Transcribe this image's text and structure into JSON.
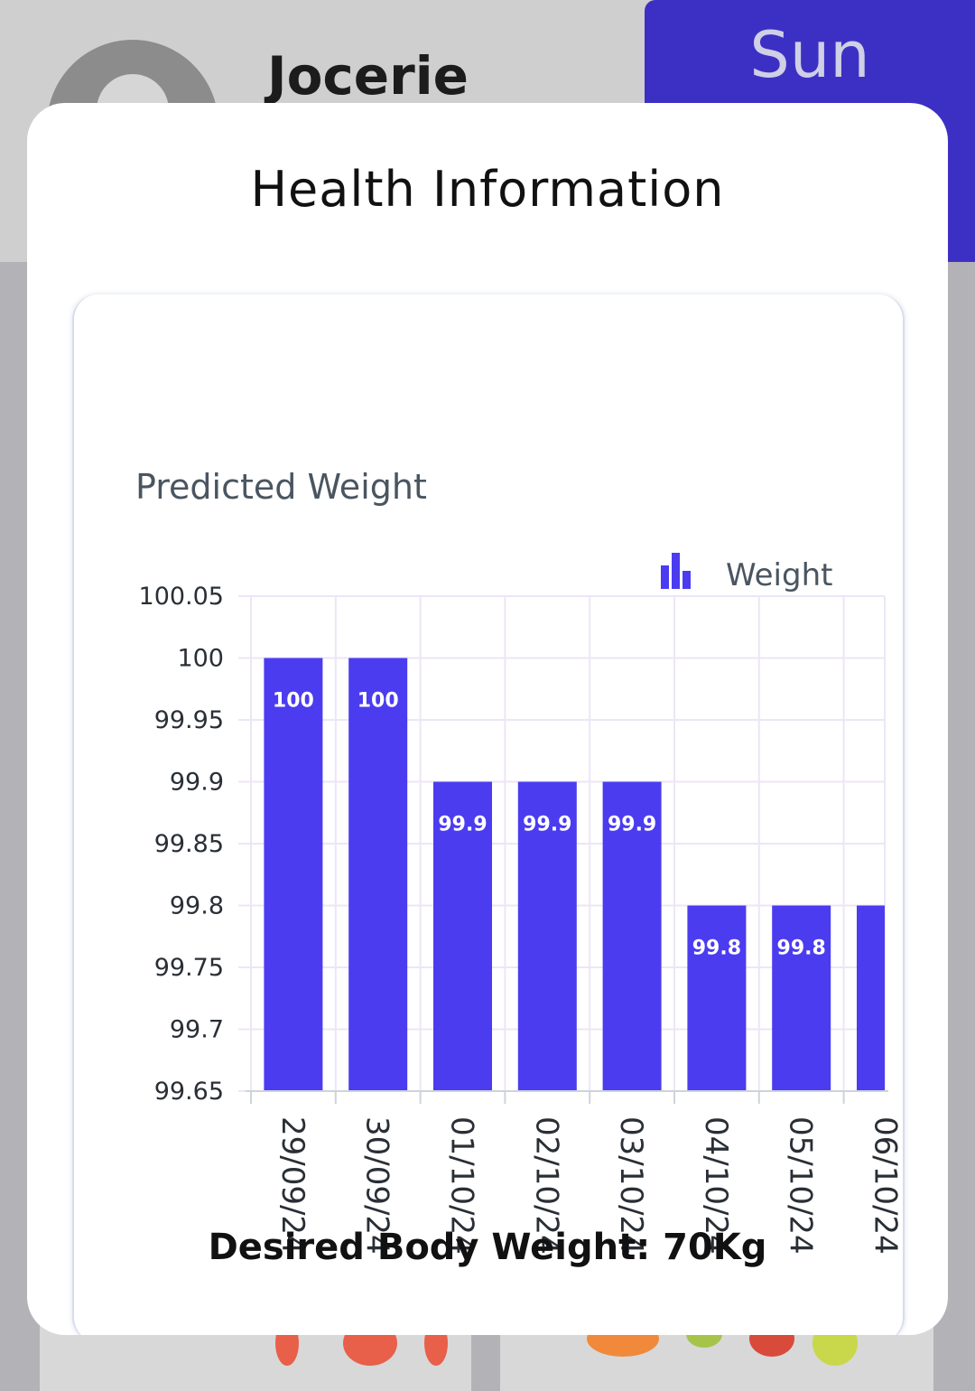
{
  "background": {
    "user_name": "Jocerie",
    "day_tab": "Sun"
  },
  "modal": {
    "title": "Health Information",
    "desired_weight": "Desired Body Weight: 70Kg"
  },
  "colors": {
    "bar": "#4b3cf0",
    "day_tab_bg": "#3c30c4",
    "grid": "#ece6f5"
  },
  "chart_data": {
    "type": "bar",
    "title": "Predicted Weight",
    "categories": [
      "29/09/24",
      "30/09/24",
      "01/10/24",
      "02/10/24",
      "03/10/24",
      "04/10/24",
      "05/10/24",
      "06/10/24"
    ],
    "series": [
      {
        "name": "Weight",
        "values": [
          100,
          100,
          99.9,
          99.9,
          99.9,
          99.8,
          99.8,
          99.8
        ]
      }
    ],
    "data_labels": [
      "100",
      "100",
      "99.9",
      "99.9",
      "99.9",
      "99.8",
      "99.8",
      ""
    ],
    "ylim": [
      99.65,
      100.05
    ],
    "yticks": [
      "100.05",
      "100",
      "99.95",
      "99.9",
      "99.85",
      "99.8",
      "99.75",
      "99.7",
      "99.65"
    ],
    "grid": true,
    "legend_position": "top-right",
    "legend_icon": "bar-chart-icon"
  }
}
